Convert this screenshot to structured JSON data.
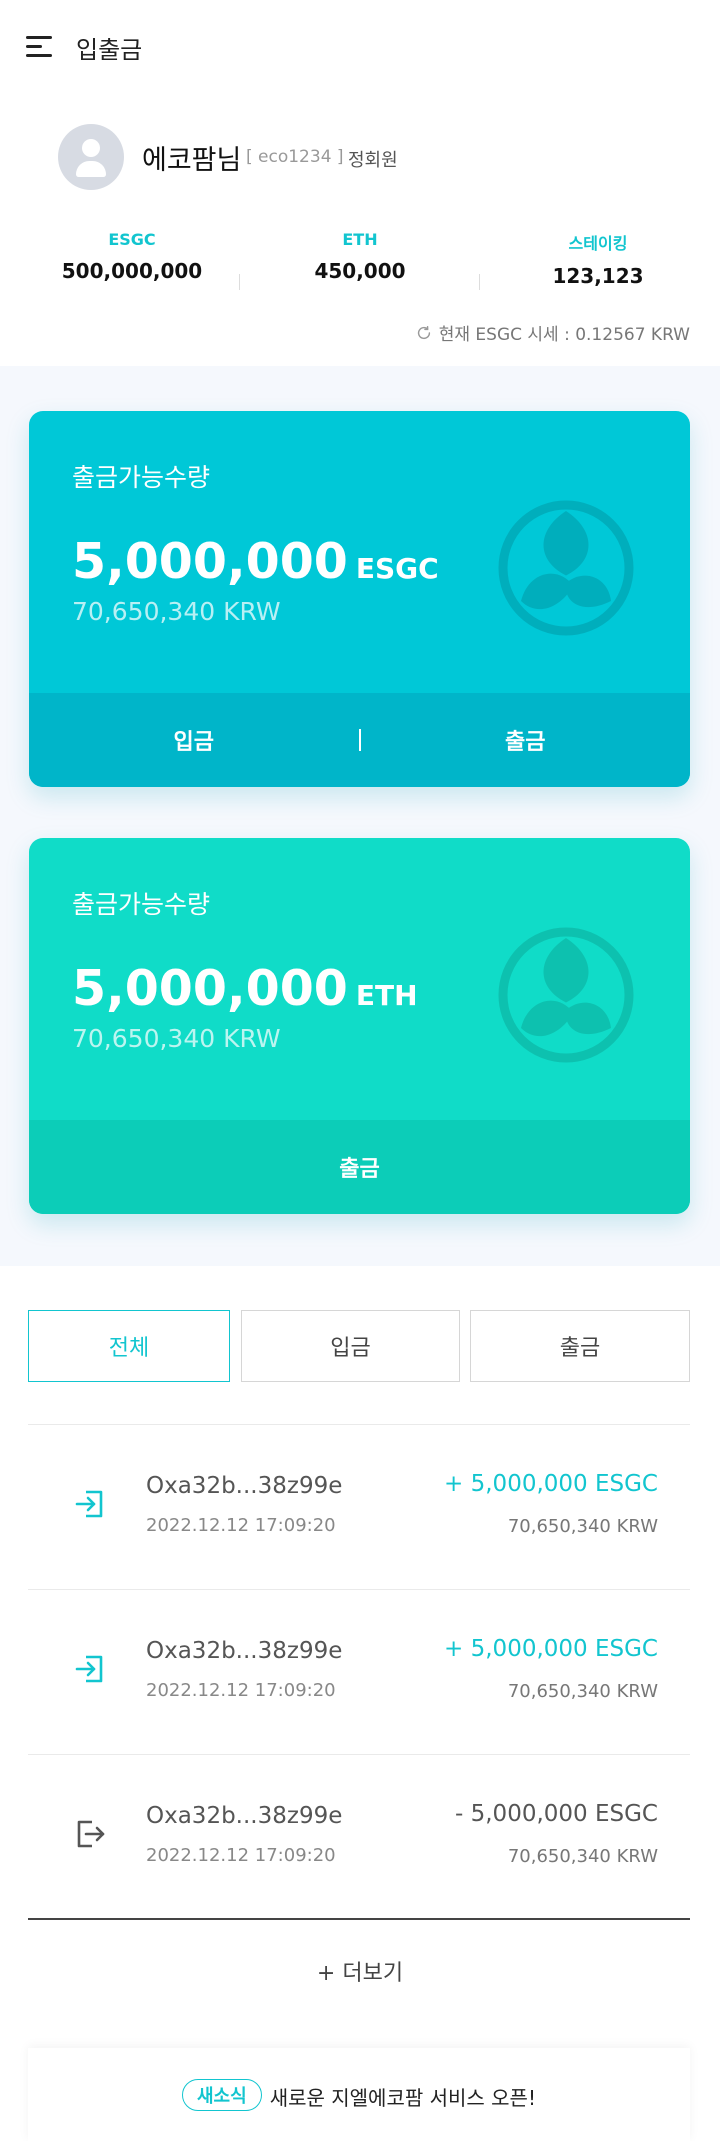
{
  "header": {
    "title": "입출금",
    "menu_icon": "hamburger-menu-icon"
  },
  "profile": {
    "name": "에코팜님",
    "user_id": "[ eco1234 ]",
    "grade": "정회원",
    "stats": [
      {
        "label": "ESGC",
        "value": "500,000,000"
      },
      {
        "label": "ETH",
        "value": "450,000"
      },
      {
        "label": "스테이킹",
        "value": "123,123"
      }
    ],
    "rate_text": "현재 ESGC 시세 : 0.12567 KRW"
  },
  "cards": [
    {
      "label": "출금가능수량",
      "amount": "5,000,000",
      "unit": "ESGC",
      "krw": "70,650,340 KRW",
      "buttons": [
        "입금",
        "출금"
      ],
      "color": "#00c8d7"
    },
    {
      "label": "출금가능수량",
      "amount": "5,000,000",
      "unit": "ETH",
      "krw": "70,650,340 KRW",
      "buttons": [
        "출금"
      ],
      "color": "#10dcc8"
    }
  ],
  "filter_tabs": [
    "전체",
    "입금",
    "출금"
  ],
  "active_tab": "전체",
  "transactions": [
    {
      "type": "deposit",
      "address": "Oxa32b...38z99e",
      "date": "2022.12.12 17:09:20",
      "amount": "+ 5,000,000 ESGC",
      "krw": "70,650,340 KRW",
      "icon": "deposit-icon"
    },
    {
      "type": "deposit",
      "address": "Oxa32b...38z99e",
      "date": "2022.12.12 17:09:20",
      "amount": "+ 5,000,000 ESGC",
      "krw": "70,650,340 KRW",
      "icon": "deposit-icon"
    },
    {
      "type": "withdraw",
      "address": "Oxa32b...38z99e",
      "date": "2022.12.12 17:09:20",
      "amount": "- 5,000,000 ESGC",
      "krw": "70,650,340 KRW",
      "icon": "withdraw-icon"
    }
  ],
  "more_label": "+ 더보기",
  "notice": {
    "badge": "새소식",
    "text": "새로운 지엘에코팜 서비스 오픈!"
  },
  "colors": {
    "accent": "#12c5cf",
    "card_esgc": "#00c8d7",
    "card_eth": "#10dcc8"
  }
}
